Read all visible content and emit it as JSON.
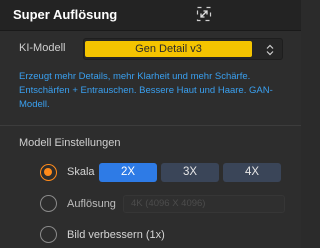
{
  "panel": {
    "title": "Super Auflösung",
    "expand_icon": "expand-diagonal-icon"
  },
  "model": {
    "label": "KI-Modell",
    "selected": "Gen Detail v3",
    "highlight_color": "#f4c400",
    "description": "Erzeugt mehr Details, mehr Klarheit und mehr Schärfe. Entschärfen + Entrauschen. Bessere Haut und Haare. GAN-Modell."
  },
  "settings": {
    "title": "Modell Einstellungen",
    "accent_color": "#ff8a1a",
    "scale": {
      "label": "Skala",
      "checked": true,
      "options": [
        "2X",
        "3X",
        "4X"
      ],
      "selected": "2X",
      "active_color": "#2e7be6"
    },
    "resolution": {
      "label": "Auflösung",
      "checked": false,
      "value": "4K (4096 X 4096)"
    },
    "enhance": {
      "label": "Bild verbessern (1x)",
      "checked": false
    }
  }
}
